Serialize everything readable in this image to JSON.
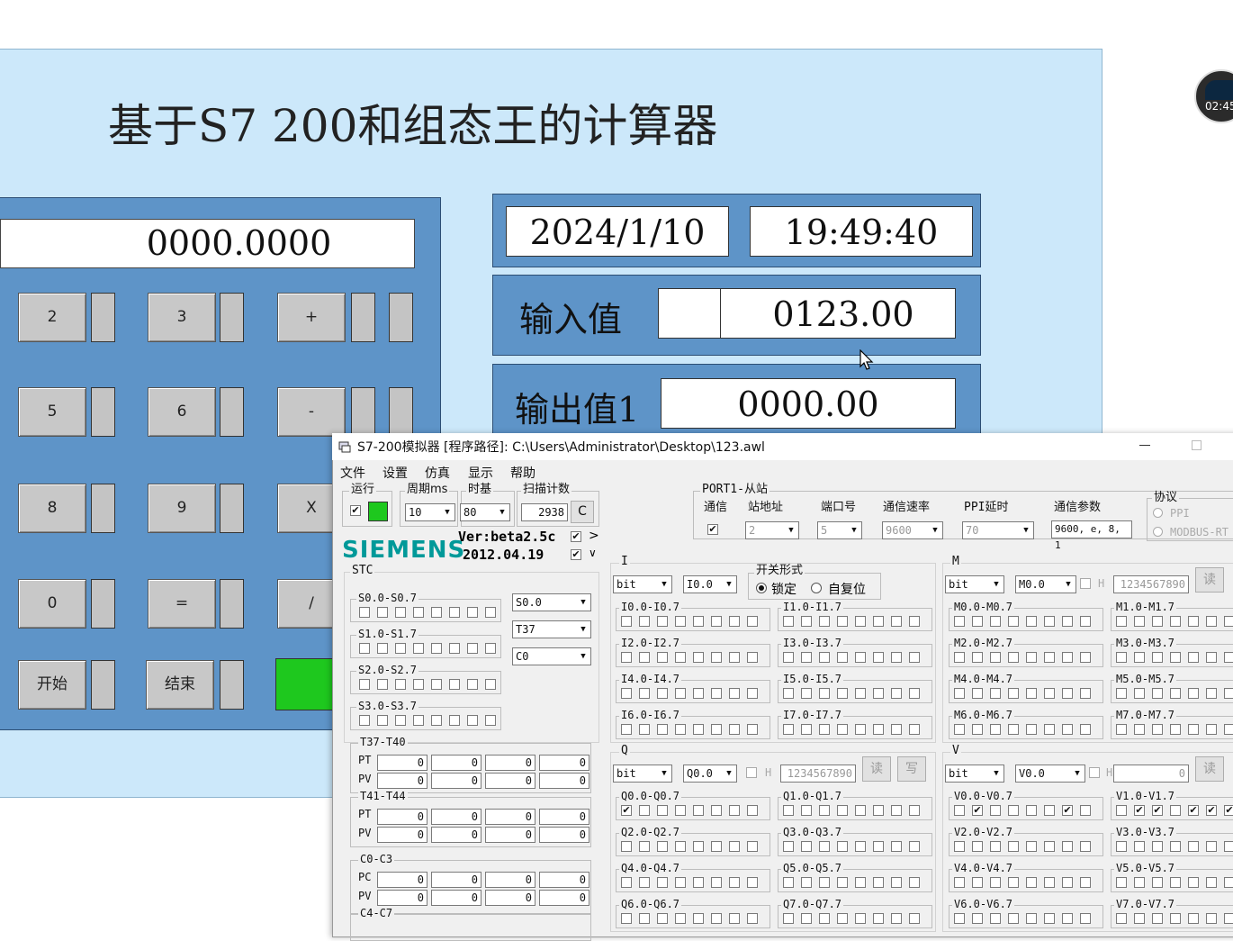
{
  "hmi": {
    "title": "基于S7 200和组态王的计算器",
    "display": "0000.0000",
    "date": "2024/1/10",
    "time": "19:49:40",
    "input_label": "输入值",
    "input_value": "0123.00",
    "output_label": "输出值1",
    "output_value": "0000.00",
    "keys": {
      "k2": "2",
      "k3": "3",
      "plus": "+",
      "k5": "5",
      "k6": "6",
      "minus": "-",
      "k8": "8",
      "k9": "9",
      "mul": "X",
      "k0": "0",
      "eq": "=",
      "div": "/",
      "start": "开始",
      "end": "结束"
    },
    "accent_green": "#1ec81e",
    "recording_badge": "02:45"
  },
  "sim": {
    "title": "S7-200模拟器 [程序路径]: C:\\Users\\Administrator\\Desktop\\123.awl",
    "menu": [
      "文件",
      "设置",
      "仿真",
      "显示",
      "帮助"
    ],
    "run_label": "运行",
    "period_label": "周期ms",
    "period_value": "10",
    "timebase_label": "时基",
    "timebase_value": "80",
    "scan_label": "扫描计数",
    "scan_value": "2938",
    "clear_btn": "C",
    "brand": "SIEMENS",
    "version": "Ver:beta2.5c",
    "date": "2012.04.19",
    "stc_label": "STC",
    "s_groups": [
      "S0.0-S0.7",
      "S1.0-S1.7",
      "S2.0-S2.7",
      "S3.0-S3.7"
    ],
    "s_selects": [
      "S0.0",
      "T37",
      "C0"
    ],
    "timers1_label": "T37-T40",
    "timers2_label": "T41-T44",
    "counters_label": "C0-C3",
    "counters2_label": "C4-C7",
    "pt": "PT",
    "pv": "PV",
    "pc": "PC",
    "zero": "0",
    "port": {
      "label": "PORT1-从站",
      "comm": "通信",
      "station_label": "站地址",
      "station": "2",
      "port_label": "端口号",
      "port": "5",
      "baud_label": "通信速率",
      "baud": "9600",
      "ppi_delay_label": "PPI延时",
      "ppi_delay": "70",
      "params_label": "通信参数",
      "params": "9600, e, 8, 1",
      "proto_label": "协议",
      "proto_ppi": "PPI",
      "proto_modbus": "MODBUS-RT"
    },
    "i_section": {
      "label": "I",
      "type": "bit",
      "addr": "I0.0",
      "switch_label": "开关形式",
      "lock": "锁定",
      "self_reset": "自复位",
      "groups": [
        "I0.0-I0.7",
        "I1.0-I1.7",
        "I2.0-I2.7",
        "I3.0-I3.7",
        "I4.0-I4.7",
        "I5.0-I5.7",
        "I6.0-I6.7",
        "I7.0-I7.7"
      ]
    },
    "q_section": {
      "label": "Q",
      "type": "bit",
      "addr": "Q0.0",
      "h": "H",
      "value": "1234567890",
      "read": "读",
      "write": "写",
      "groups": [
        "Q0.0-Q0.7",
        "Q1.0-Q1.7",
        "Q2.0-Q2.7",
        "Q3.0-Q3.7",
        "Q4.0-Q4.7",
        "Q5.0-Q5.7",
        "Q6.0-Q6.7",
        "Q7.0-Q7.7"
      ]
    },
    "m_section": {
      "label": "M",
      "type": "bit",
      "addr": "M0.0",
      "h": "H",
      "value": "1234567890",
      "read": "读",
      "groups": [
        "M0.0-M0.7",
        "M1.0-M1.7",
        "M2.0-M2.7",
        "M3.0-M3.7",
        "M4.0-M4.7",
        "M5.0-M5.7",
        "M6.0-M6.7",
        "M7.0-M7.7"
      ]
    },
    "v_section": {
      "label": "V",
      "type": "bit",
      "addr": "V0.0",
      "h": "H",
      "value": "0",
      "read": "读",
      "groups": [
        "V0.0-V0.7",
        "V1.0-V1.7",
        "V2.0-V2.7",
        "V3.0-V3.7",
        "V4.0-V4.7",
        "V5.0-V5.7",
        "V6.0-V6.7",
        "V7.0-V7.7"
      ]
    },
    "checked_bits": {
      "Q0.0-Q0.7": [
        0
      ],
      "V0.0-V0.7": [
        1,
        6
      ],
      "V1.0-V1.7": [
        1,
        2,
        4,
        5,
        6
      ]
    }
  }
}
